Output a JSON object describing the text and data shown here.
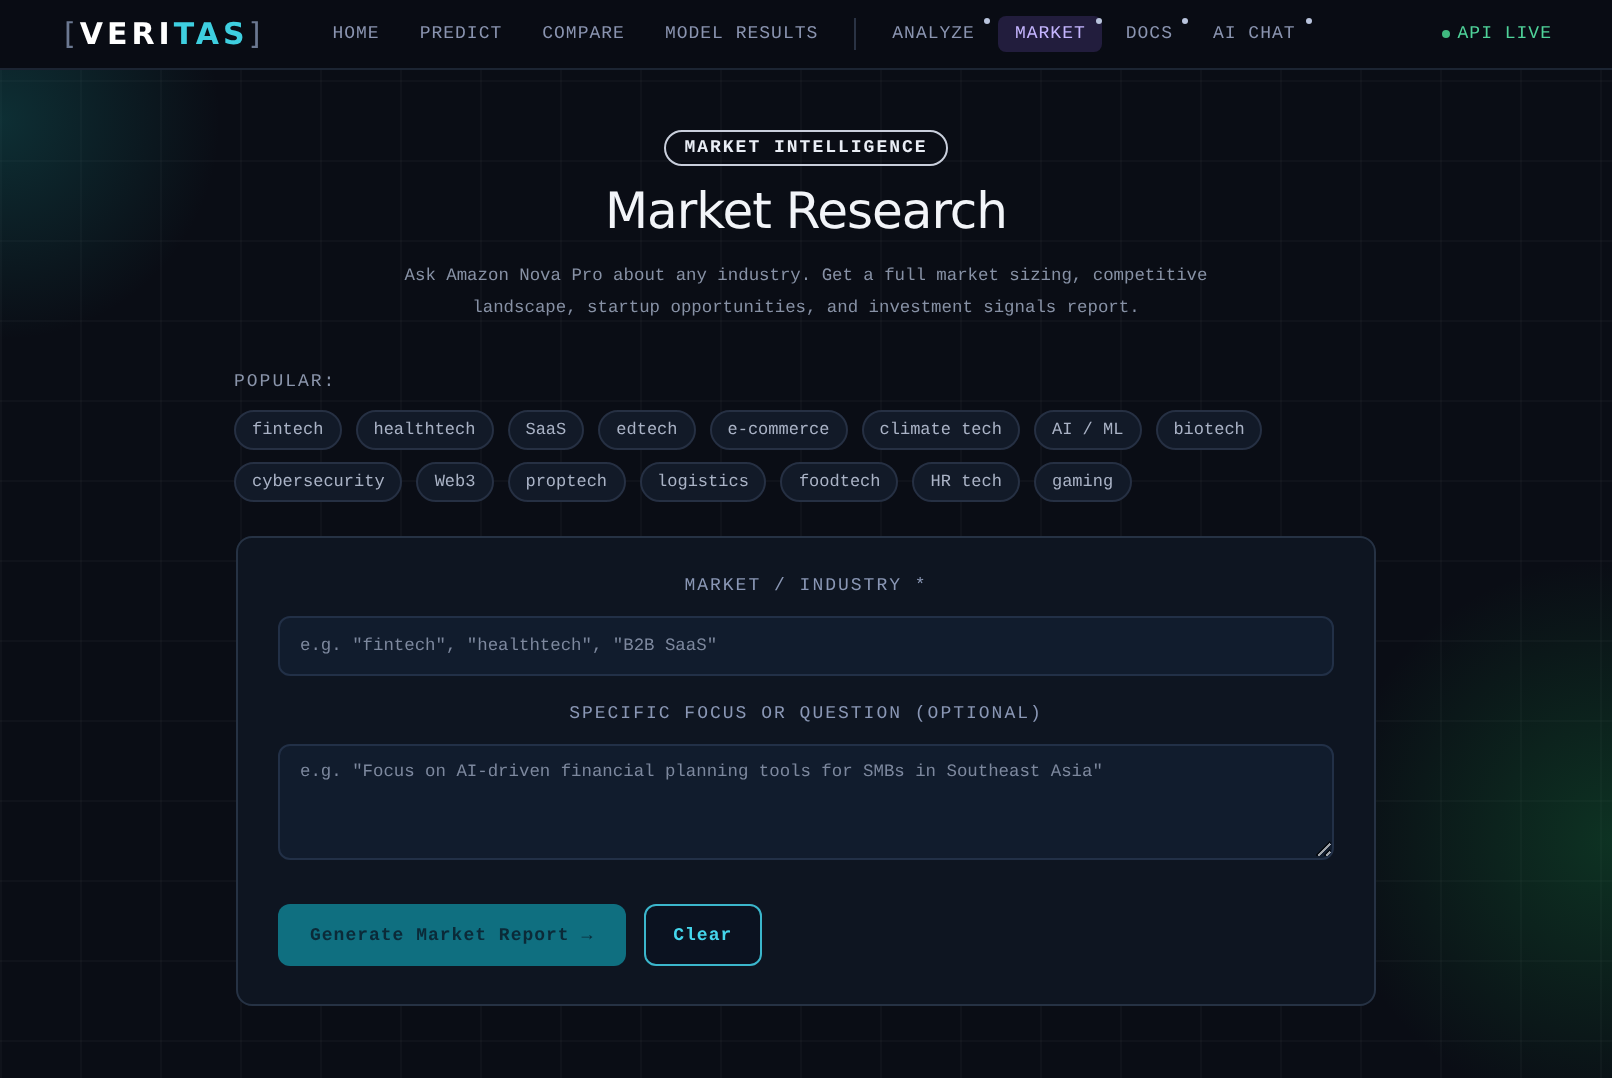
{
  "header": {
    "logo": {
      "left": "[",
      "main": "VERI",
      "accent": "TAS",
      "right": "]"
    },
    "nav": [
      {
        "label": "HOME",
        "selected": false,
        "badge": false
      },
      {
        "label": "PREDICT",
        "selected": false,
        "badge": false
      },
      {
        "label": "COMPARE",
        "selected": false,
        "badge": false
      },
      {
        "label": "MODEL RESULTS",
        "selected": false,
        "badge": false
      },
      {
        "label": "ANALYZE",
        "selected": false,
        "badge": true
      },
      {
        "label": "MARKET",
        "selected": true,
        "badge": true
      },
      {
        "label": "DOCS",
        "selected": false,
        "badge": true
      },
      {
        "label": "AI CHAT",
        "selected": false,
        "badge": true
      }
    ],
    "status": {
      "label": "API LIVE",
      "on": true
    }
  },
  "hero": {
    "badge": "MARKET INTELLIGENCE",
    "title": "Market Research",
    "description": "Ask Amazon Nova Pro about any industry. Get a full market sizing, competitive landscape, startup opportunities, and investment signals report."
  },
  "popular": {
    "label": "POPULAR:",
    "chips": [
      "fintech",
      "healthtech",
      "SaaS",
      "edtech",
      "e-commerce",
      "climate tech",
      "AI / ML",
      "biotech",
      "cybersecurity",
      "Web3",
      "proptech",
      "logistics",
      "foodtech",
      "HR tech",
      "gaming"
    ]
  },
  "form": {
    "industry_label": "MARKET / INDUSTRY *",
    "industry_placeholder": "e.g. \"fintech\", \"healthtech\", \"B2B SaaS\"",
    "focus_label": "SPECIFIC FOCUS OR QUESTION (OPTIONAL)",
    "focus_placeholder": "e.g. \"Focus on AI-driven financial planning tools for SMBs in Southeast Asia\"",
    "buttons": [
      {
        "label": "Generate Market Report →",
        "kind": "primary"
      },
      {
        "label": "Clear",
        "kind": "secondary"
      }
    ]
  }
}
